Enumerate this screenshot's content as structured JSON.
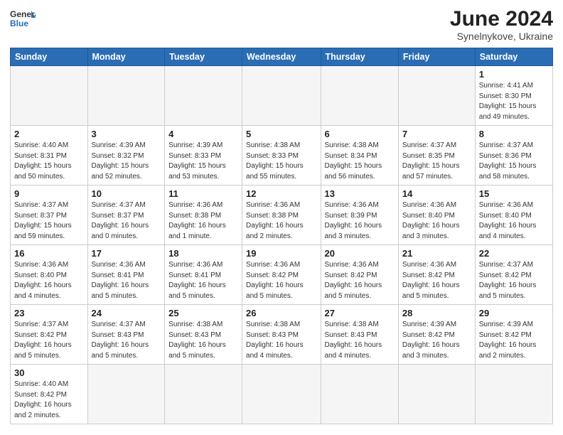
{
  "logo": {
    "text_general": "General",
    "text_blue": "Blue"
  },
  "title": {
    "month_year": "June 2024",
    "location": "Synelnykove, Ukraine"
  },
  "weekdays": [
    "Sunday",
    "Monday",
    "Tuesday",
    "Wednesday",
    "Thursday",
    "Friday",
    "Saturday"
  ],
  "weeks": [
    [
      {
        "day": "",
        "info": ""
      },
      {
        "day": "",
        "info": ""
      },
      {
        "day": "",
        "info": ""
      },
      {
        "day": "",
        "info": ""
      },
      {
        "day": "",
        "info": ""
      },
      {
        "day": "",
        "info": ""
      },
      {
        "day": "1",
        "info": "Sunrise: 4:41 AM\nSunset: 8:30 PM\nDaylight: 15 hours\nand 49 minutes."
      }
    ],
    [
      {
        "day": "2",
        "info": "Sunrise: 4:40 AM\nSunset: 8:31 PM\nDaylight: 15 hours\nand 50 minutes."
      },
      {
        "day": "3",
        "info": "Sunrise: 4:39 AM\nSunset: 8:32 PM\nDaylight: 15 hours\nand 52 minutes."
      },
      {
        "day": "4",
        "info": "Sunrise: 4:39 AM\nSunset: 8:33 PM\nDaylight: 15 hours\nand 53 minutes."
      },
      {
        "day": "5",
        "info": "Sunrise: 4:38 AM\nSunset: 8:33 PM\nDaylight: 15 hours\nand 55 minutes."
      },
      {
        "day": "6",
        "info": "Sunrise: 4:38 AM\nSunset: 8:34 PM\nDaylight: 15 hours\nand 56 minutes."
      },
      {
        "day": "7",
        "info": "Sunrise: 4:37 AM\nSunset: 8:35 PM\nDaylight: 15 hours\nand 57 minutes."
      },
      {
        "day": "8",
        "info": "Sunrise: 4:37 AM\nSunset: 8:36 PM\nDaylight: 15 hours\nand 58 minutes."
      }
    ],
    [
      {
        "day": "9",
        "info": "Sunrise: 4:37 AM\nSunset: 8:37 PM\nDaylight: 15 hours\nand 59 minutes."
      },
      {
        "day": "10",
        "info": "Sunrise: 4:37 AM\nSunset: 8:37 PM\nDaylight: 16 hours\nand 0 minutes."
      },
      {
        "day": "11",
        "info": "Sunrise: 4:36 AM\nSunset: 8:38 PM\nDaylight: 16 hours\nand 1 minute."
      },
      {
        "day": "12",
        "info": "Sunrise: 4:36 AM\nSunset: 8:38 PM\nDaylight: 16 hours\nand 2 minutes."
      },
      {
        "day": "13",
        "info": "Sunrise: 4:36 AM\nSunset: 8:39 PM\nDaylight: 16 hours\nand 3 minutes."
      },
      {
        "day": "14",
        "info": "Sunrise: 4:36 AM\nSunset: 8:40 PM\nDaylight: 16 hours\nand 3 minutes."
      },
      {
        "day": "15",
        "info": "Sunrise: 4:36 AM\nSunset: 8:40 PM\nDaylight: 16 hours\nand 4 minutes."
      }
    ],
    [
      {
        "day": "16",
        "info": "Sunrise: 4:36 AM\nSunset: 8:40 PM\nDaylight: 16 hours\nand 4 minutes."
      },
      {
        "day": "17",
        "info": "Sunrise: 4:36 AM\nSunset: 8:41 PM\nDaylight: 16 hours\nand 5 minutes."
      },
      {
        "day": "18",
        "info": "Sunrise: 4:36 AM\nSunset: 8:41 PM\nDaylight: 16 hours\nand 5 minutes."
      },
      {
        "day": "19",
        "info": "Sunrise: 4:36 AM\nSunset: 8:42 PM\nDaylight: 16 hours\nand 5 minutes."
      },
      {
        "day": "20",
        "info": "Sunrise: 4:36 AM\nSunset: 8:42 PM\nDaylight: 16 hours\nand 5 minutes."
      },
      {
        "day": "21",
        "info": "Sunrise: 4:36 AM\nSunset: 8:42 PM\nDaylight: 16 hours\nand 5 minutes."
      },
      {
        "day": "22",
        "info": "Sunrise: 4:37 AM\nSunset: 8:42 PM\nDaylight: 16 hours\nand 5 minutes."
      }
    ],
    [
      {
        "day": "23",
        "info": "Sunrise: 4:37 AM\nSunset: 8:42 PM\nDaylight: 16 hours\nand 5 minutes."
      },
      {
        "day": "24",
        "info": "Sunrise: 4:37 AM\nSunset: 8:43 PM\nDaylight: 16 hours\nand 5 minutes."
      },
      {
        "day": "25",
        "info": "Sunrise: 4:38 AM\nSunset: 8:43 PM\nDaylight: 16 hours\nand 5 minutes."
      },
      {
        "day": "26",
        "info": "Sunrise: 4:38 AM\nSunset: 8:43 PM\nDaylight: 16 hours\nand 4 minutes."
      },
      {
        "day": "27",
        "info": "Sunrise: 4:38 AM\nSunset: 8:43 PM\nDaylight: 16 hours\nand 4 minutes."
      },
      {
        "day": "28",
        "info": "Sunrise: 4:39 AM\nSunset: 8:42 PM\nDaylight: 16 hours\nand 3 minutes."
      },
      {
        "day": "29",
        "info": "Sunrise: 4:39 AM\nSunset: 8:42 PM\nDaylight: 16 hours\nand 2 minutes."
      }
    ],
    [
      {
        "day": "30",
        "info": "Sunrise: 4:40 AM\nSunset: 8:42 PM\nDaylight: 16 hours\nand 2 minutes."
      },
      {
        "day": "",
        "info": ""
      },
      {
        "day": "",
        "info": ""
      },
      {
        "day": "",
        "info": ""
      },
      {
        "day": "",
        "info": ""
      },
      {
        "day": "",
        "info": ""
      },
      {
        "day": "",
        "info": ""
      }
    ]
  ]
}
